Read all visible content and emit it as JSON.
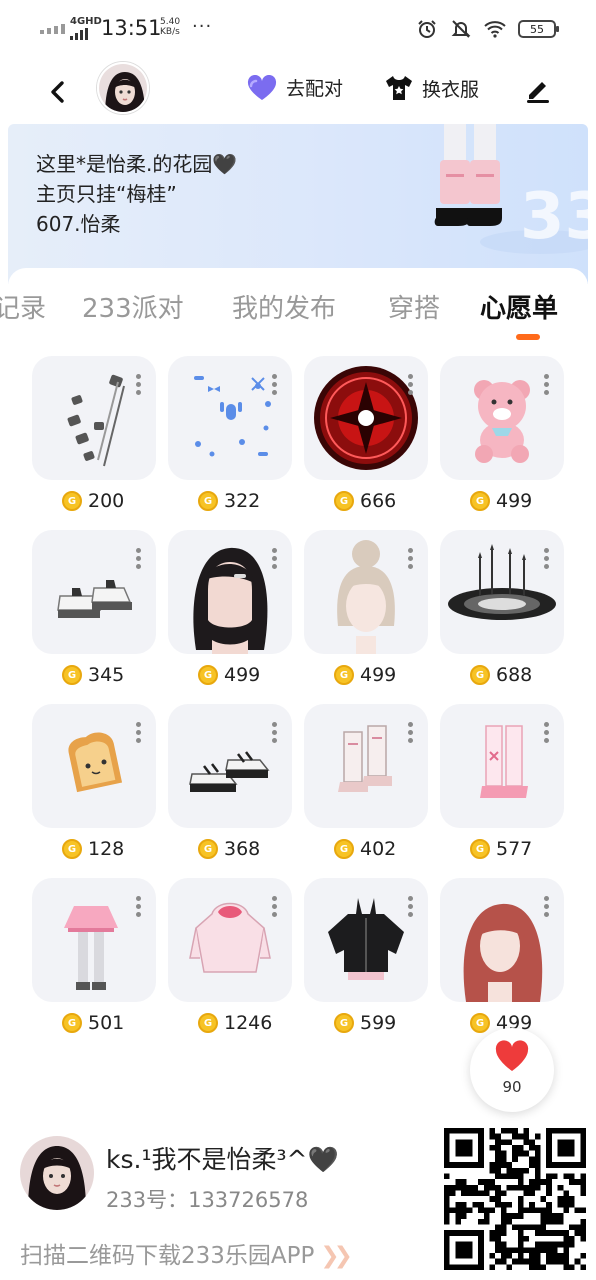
{
  "status_bar": {
    "network": "4GHD",
    "time": "13:51",
    "speed_value": "5.40",
    "speed_unit": "KB/s",
    "more": "···",
    "battery": "55"
  },
  "nav": {
    "pair_label": "去配对",
    "dress_label": "换衣服",
    "icons": {
      "back": "chevron-left",
      "pair": "purple-heart",
      "dress": "tshirt",
      "edit": "pen"
    }
  },
  "banner": {
    "line1": "这里*是怡柔.的花园🖤",
    "line2": "主页只挂“梅桂”",
    "line3": " 607.怡柔"
  },
  "tabs": [
    {
      "label": "记录",
      "active": false
    },
    {
      "label": "233派对",
      "active": false
    },
    {
      "label": "我的发布",
      "active": false
    },
    {
      "label": "穿搭",
      "active": false
    },
    {
      "label": "心愿单",
      "active": true
    }
  ],
  "accent_color": "#ff6a1a",
  "coin_color": "#f7c325",
  "wishlist": [
    {
      "price": "200",
      "item": "grey-hair-clips"
    },
    {
      "price": "322",
      "item": "blue-hair-accessories"
    },
    {
      "price": "666",
      "item": "red-magic-circle"
    },
    {
      "price": "499",
      "item": "pink-teddy-bear"
    },
    {
      "price": "345",
      "item": "white-platform-shoes"
    },
    {
      "price": "499",
      "item": "black-wavy-hair"
    },
    {
      "price": "499",
      "item": "cream-bun-hair"
    },
    {
      "price": "688",
      "item": "dark-ground-effect"
    },
    {
      "price": "128",
      "item": "toast-bread"
    },
    {
      "price": "368",
      "item": "black-white-sneakers"
    },
    {
      "price": "402",
      "item": "pink-white-boots"
    },
    {
      "price": "577",
      "item": "pink-leg-warmers"
    },
    {
      "price": "501",
      "item": "pink-skirt-stockings"
    },
    {
      "price": "1246",
      "item": "pink-hoodie"
    },
    {
      "price": "599",
      "item": "black-bunny-jacket"
    },
    {
      "price": "499",
      "item": "auburn-long-hair"
    }
  ],
  "like": {
    "count": "90"
  },
  "footer": {
    "name": "ks.¹我不是怡柔³^🖤",
    "id_line": "233号：133726578",
    "cta": "扫描二维码下载233乐园APP",
    "cta_arrows": "❯❯"
  }
}
